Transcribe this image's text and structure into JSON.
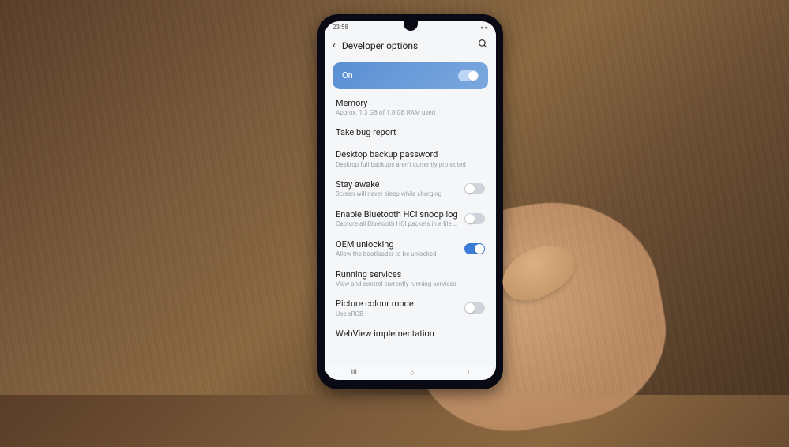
{
  "status": {
    "time": "23:58"
  },
  "header": {
    "title": "Developer options"
  },
  "master": {
    "label": "On",
    "on": true
  },
  "items": [
    {
      "title": "Memory",
      "sub": "Approx. 1.3 GB of 1.8 GB RAM used",
      "toggle": null
    },
    {
      "title": "Take bug report",
      "sub": "",
      "toggle": null
    },
    {
      "title": "Desktop backup password",
      "sub": "Desktop full backups aren't currently protected",
      "toggle": null
    },
    {
      "title": "Stay awake",
      "sub": "Screen will never sleep while charging",
      "toggle": false
    },
    {
      "title": "Enable Bluetooth HCI snoop log",
      "sub": "Capture all Bluetooth HCI packets in a file (Toggle Bluetooth after changing this setting)",
      "toggle": false
    },
    {
      "title": "OEM unlocking",
      "sub": "Allow the bootloader to be unlocked",
      "toggle": true
    },
    {
      "title": "Running services",
      "sub": "View and control currently running services",
      "toggle": null
    },
    {
      "title": "Picture colour mode",
      "sub": "Use sRGB",
      "toggle": false
    },
    {
      "title": "WebView implementation",
      "sub": "",
      "toggle": null
    }
  ],
  "nav": {
    "recent": "III",
    "home": "○",
    "back": "‹"
  }
}
